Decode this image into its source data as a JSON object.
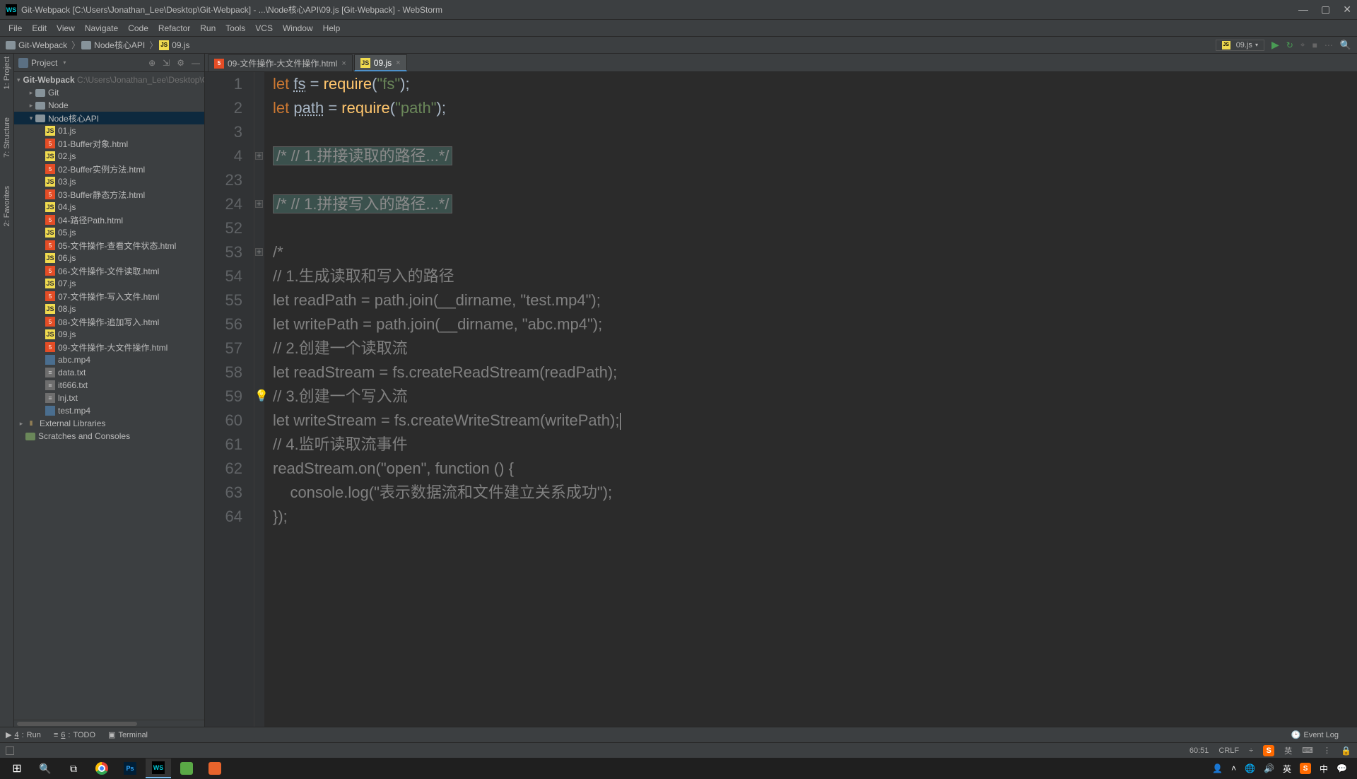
{
  "window": {
    "title": "Git-Webpack [C:\\Users\\Jonathan_Lee\\Desktop\\Git-Webpack] - ...\\Node核心API\\09.js [Git-Webpack] - WebStorm"
  },
  "menu": [
    "File",
    "Edit",
    "View",
    "Navigate",
    "Code",
    "Refactor",
    "Run",
    "Tools",
    "VCS",
    "Window",
    "Help"
  ],
  "breadcrumb": {
    "root": "Git-Webpack",
    "mid": "Node核心API",
    "file": "09.js"
  },
  "runconfig": {
    "selected": "09.js"
  },
  "project_panel": {
    "title": "Project",
    "root": {
      "name": "Git-Webpack",
      "hint": "C:\\Users\\Jonathan_Lee\\Desktop\\Git-We"
    },
    "folders": {
      "git": "Git",
      "node": "Node",
      "nodeapi": "Node核心API"
    },
    "files": [
      {
        "name": "01.js",
        "type": "js"
      },
      {
        "name": "01-Buffer对象.html",
        "type": "html"
      },
      {
        "name": "02.js",
        "type": "js"
      },
      {
        "name": "02-Buffer实例方法.html",
        "type": "html"
      },
      {
        "name": "03.js",
        "type": "js"
      },
      {
        "name": "03-Buffer静态方法.html",
        "type": "html"
      },
      {
        "name": "04.js",
        "type": "js"
      },
      {
        "name": "04-路径Path.html",
        "type": "html"
      },
      {
        "name": "05.js",
        "type": "js"
      },
      {
        "name": "05-文件操作-查看文件状态.html",
        "type": "html"
      },
      {
        "name": "06.js",
        "type": "js"
      },
      {
        "name": "06-文件操作-文件读取.html",
        "type": "html"
      },
      {
        "name": "07.js",
        "type": "js"
      },
      {
        "name": "07-文件操作-写入文件.html",
        "type": "html"
      },
      {
        "name": "08.js",
        "type": "js"
      },
      {
        "name": "08-文件操作-追加写入.html",
        "type": "html"
      },
      {
        "name": "09.js",
        "type": "js"
      },
      {
        "name": "09-文件操作-大文件操作.html",
        "type": "html"
      },
      {
        "name": "abc.mp4",
        "type": "mp4"
      },
      {
        "name": "data.txt",
        "type": "txt"
      },
      {
        "name": "it666.txt",
        "type": "txt"
      },
      {
        "name": "lnj.txt",
        "type": "txt"
      },
      {
        "name": "test.mp4",
        "type": "mp4"
      }
    ],
    "external": "External Libraries",
    "scratches": "Scratches and Consoles"
  },
  "tabs": [
    {
      "label": "09-文件操作-大文件操作.html",
      "type": "html",
      "active": false
    },
    {
      "label": "09.js",
      "type": "js",
      "active": true
    }
  ],
  "code": {
    "lines": [
      {
        "n": 1,
        "html": "<span class='kw'>let</span> <span class='id-u'>fs</span> = <span class='fn'>require</span>(<span class='str'>\"fs\"</span>);"
      },
      {
        "n": 2,
        "html": "<span class='kw'>let</span> <span class='id-u'>path</span> = <span class='fn'>require</span>(<span class='str'>\"path\"</span>);"
      },
      {
        "n": 3,
        "html": ""
      },
      {
        "n": 4,
        "html": "<span class='folded'>/* // 1.拼接读取的路径...*/</span>",
        "fold": true
      },
      {
        "n": 23,
        "html": ""
      },
      {
        "n": 24,
        "html": "<span class='folded'>/* // 1.拼接写入的路径...*/</span>",
        "fold": true
      },
      {
        "n": 52,
        "html": ""
      },
      {
        "n": 53,
        "html": "<span class='cm'>/*</span>",
        "fold": true
      },
      {
        "n": 54,
        "html": "<span class='cm'>// 1.生成读取和写入的路径</span>"
      },
      {
        "n": 55,
        "html": "<span class='cm'>let readPath = path.join(__dirname, \"test.mp4\");</span>"
      },
      {
        "n": 56,
        "html": "<span class='cm'>let writePath = path.join(__dirname, \"abc.mp4\");</span>"
      },
      {
        "n": 57,
        "html": "<span class='cm'>// 2.创建一个读取流</span>"
      },
      {
        "n": 58,
        "html": "<span class='cm'>let readStream = fs.createReadStream(readPath);</span>"
      },
      {
        "n": 59,
        "html": "<span class='cm'>// 3.创建一个写入流</span>",
        "bulb": true
      },
      {
        "n": 60,
        "html": "<span class='cm'>let writeStream = fs.createWriteStream(writePath);</span><span class='caret'></span>"
      },
      {
        "n": 61,
        "html": "<span class='cm'>// 4.监听读取流事件</span>"
      },
      {
        "n": 62,
        "html": "<span class='cm'>readStream.on(\"open\", function () {</span>"
      },
      {
        "n": 63,
        "html": "<span class='cm'>    console.log(\"表示数据流和文件建立关系成功\");</span>"
      },
      {
        "n": 64,
        "html": "<span class='cm'>});</span>"
      }
    ]
  },
  "bottom_tools": {
    "run": "Run",
    "todo": "TODO",
    "terminal": "Terminal",
    "eventlog": "Event Log"
  },
  "status": {
    "pos": "60:51",
    "lineend": "CRLF",
    "ime": "英",
    "lock": "🔒"
  },
  "tray": {
    "ime1": "英",
    "ime2": "中"
  }
}
